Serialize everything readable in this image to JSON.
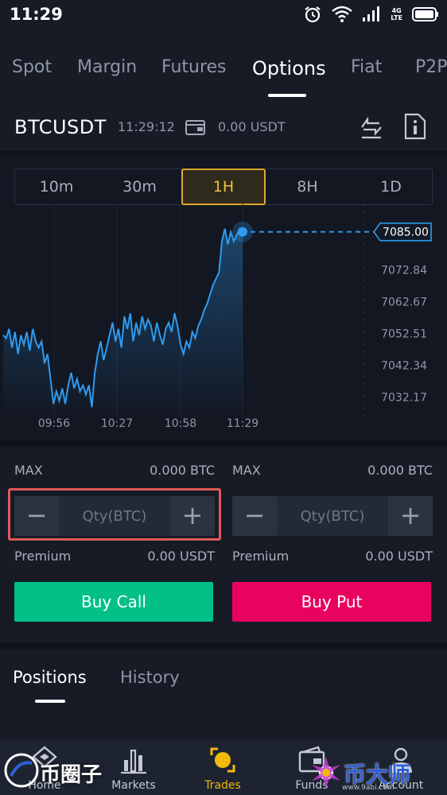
{
  "status_bar": {
    "time": "11:29",
    "network": "4G",
    "network_sub": "LTE"
  },
  "tabs": [
    {
      "label": "Spot"
    },
    {
      "label": "Margin"
    },
    {
      "label": "Futures"
    },
    {
      "label": "Options"
    },
    {
      "label": "Fiat"
    },
    {
      "label": "P2P"
    }
  ],
  "active_tab": "Options",
  "pair": {
    "name": "BTCUSDT",
    "time": "11:29:12",
    "balance": "0.00 USDT"
  },
  "intervals": [
    {
      "label": "10m"
    },
    {
      "label": "30m"
    },
    {
      "label": "1H"
    },
    {
      "label": "8H"
    },
    {
      "label": "1D"
    }
  ],
  "active_interval": "1H",
  "chart_data": {
    "type": "line",
    "x_ticks": [
      "09:56",
      "10:27",
      "10:58",
      "11:29"
    ],
    "y_ticks": [
      "7072.84",
      "7062.67",
      "7052.51",
      "7042.34",
      "7032.17"
    ],
    "current_value": "7085.00",
    "current_numeric": 7085.0,
    "ylim": [
      7028,
      7090
    ],
    "points": [
      [
        0,
        7052
      ],
      [
        2,
        7051
      ],
      [
        4,
        7054
      ],
      [
        6,
        7048
      ],
      [
        8,
        7053
      ],
      [
        10,
        7046
      ],
      [
        12,
        7052
      ],
      [
        14,
        7049
      ],
      [
        16,
        7053
      ],
      [
        18,
        7047
      ],
      [
        20,
        7054
      ],
      [
        22,
        7050
      ],
      [
        24,
        7048
      ],
      [
        26,
        7050
      ],
      [
        28,
        7043
      ],
      [
        30,
        7046
      ],
      [
        32,
        7038
      ],
      [
        34,
        7030
      ],
      [
        36,
        7034
      ],
      [
        38,
        7031
      ],
      [
        40,
        7035
      ],
      [
        42,
        7030
      ],
      [
        44,
        7036
      ],
      [
        46,
        7040
      ],
      [
        48,
        7035
      ],
      [
        50,
        7038
      ],
      [
        52,
        7034
      ],
      [
        54,
        7036
      ],
      [
        56,
        7033
      ],
      [
        58,
        7036
      ],
      [
        60,
        7029
      ],
      [
        62,
        7040
      ],
      [
        64,
        7046
      ],
      [
        66,
        7050
      ],
      [
        68,
        7044
      ],
      [
        70,
        7048
      ],
      [
        72,
        7052
      ],
      [
        74,
        7056
      ],
      [
        76,
        7050
      ],
      [
        78,
        7054
      ],
      [
        80,
        7048
      ],
      [
        82,
        7058
      ],
      [
        84,
        7054
      ],
      [
        86,
        7059
      ],
      [
        88,
        7050
      ],
      [
        90,
        7056
      ],
      [
        92,
        7052
      ],
      [
        94,
        7058
      ],
      [
        96,
        7054
      ],
      [
        98,
        7057
      ],
      [
        100,
        7055
      ],
      [
        102,
        7050
      ],
      [
        104,
        7056
      ],
      [
        106,
        7052
      ],
      [
        108,
        7049
      ],
      [
        110,
        7054
      ],
      [
        112,
        7056
      ],
      [
        114,
        7053
      ],
      [
        116,
        7059
      ],
      [
        118,
        7055
      ],
      [
        120,
        7049
      ],
      [
        122,
        7046
      ],
      [
        124,
        7050
      ],
      [
        126,
        7048
      ],
      [
        128,
        7053
      ],
      [
        130,
        7051
      ],
      [
        132,
        7055
      ],
      [
        134,
        7057
      ],
      [
        136,
        7060
      ],
      [
        138,
        7062
      ],
      [
        140,
        7065
      ],
      [
        142,
        7068
      ],
      [
        144,
        7070
      ],
      [
        146,
        7072
      ],
      [
        148,
        7082
      ],
      [
        150,
        7086
      ],
      [
        152,
        7081
      ],
      [
        154,
        7085
      ],
      [
        156,
        7082
      ],
      [
        158,
        7084
      ],
      [
        160,
        7086
      ],
      [
        162,
        7085
      ]
    ],
    "grid": true
  },
  "order_call": {
    "max_label": "MAX",
    "max_value": "0.000 BTC",
    "qty_placeholder": "Qty(BTC)",
    "premium_label": "Premium",
    "premium_value": "0.00 USDT",
    "button": "Buy Call"
  },
  "order_put": {
    "max_label": "MAX",
    "max_value": "0.000 BTC",
    "qty_placeholder": "Qty(BTC)",
    "premium_label": "Premium",
    "premium_value": "0.00 USDT",
    "button": "Buy Put"
  },
  "bottom_tabs": {
    "positions": "Positions",
    "history": "History"
  },
  "nav": [
    {
      "label": "Home",
      "icon": "home-icon"
    },
    {
      "label": "Markets",
      "icon": "markets-icon"
    },
    {
      "label": "Trades",
      "icon": "trades-icon"
    },
    {
      "label": "Funds",
      "icon": "funds-icon"
    },
    {
      "label": "Account",
      "icon": "account-icon"
    }
  ],
  "watermark": {
    "left": "币圈子",
    "right": "币大师",
    "url": "www.9abi.com"
  },
  "colors": {
    "accent": "#f0b90b",
    "call": "#03c087",
    "put": "#e8035f",
    "chart_line": "#2f9bf0"
  }
}
